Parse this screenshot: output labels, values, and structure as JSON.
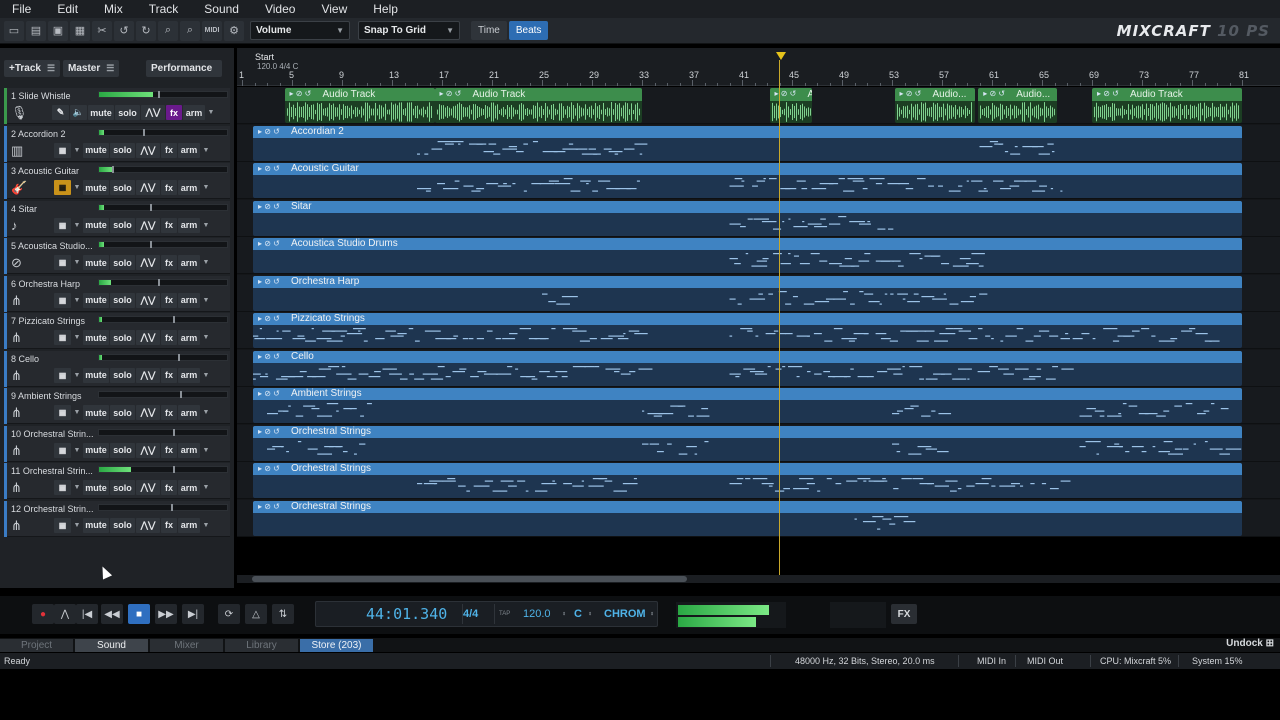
{
  "menu": [
    "File",
    "Edit",
    "Mix",
    "Track",
    "Sound",
    "Video",
    "View",
    "Help"
  ],
  "toolbar": {
    "param_select": "Volume",
    "snap_select": "Snap To Grid",
    "time_label": "Time",
    "beats_label": "Beats",
    "brand": "MIXCRAFT",
    "brand_suffix": "10 PS",
    "icons": [
      "new-icon",
      "open-icon",
      "save-icon",
      "save-as-icon",
      "cut-icon",
      "undo-icon",
      "redo-icon",
      "zoom-in-icon",
      "zoom-out-icon",
      "midi-icon",
      "settings-icon"
    ]
  },
  "track_controls": {
    "add_track": "+Track",
    "master": "Master",
    "performance": "Performance"
  },
  "buttons": {
    "mute": "mute",
    "solo": "solo",
    "fx": "fx",
    "arm": "arm"
  },
  "tracks": [
    {
      "num": "1",
      "name": "Slide Whistle",
      "icon": "microphone-icon",
      "level": 0.42,
      "pan": 0.46,
      "type": "audio",
      "fx_on": true,
      "arm_on": false
    },
    {
      "num": "2",
      "name": "Accordion 2",
      "icon": "accordion-icon",
      "level": 0.04,
      "pan": 0.34,
      "type": "midi",
      "fx_on": false,
      "arm_on": false
    },
    {
      "num": "3",
      "name": "Acoustic Guitar",
      "icon": "guitar-icon",
      "level": 0.1,
      "pan": 0.1,
      "type": "midi",
      "fx_on": false,
      "arm_on": true
    },
    {
      "num": "4",
      "name": "Sitar",
      "icon": "sitar-icon",
      "level": 0.04,
      "pan": 0.4,
      "type": "midi",
      "fx_on": false,
      "arm_on": false
    },
    {
      "num": "5",
      "name": "Acoustica Studio...",
      "icon": "drums-icon",
      "level": 0.04,
      "pan": 0.4,
      "type": "midi",
      "fx_on": false,
      "arm_on": false
    },
    {
      "num": "6",
      "name": "Orchestra Harp",
      "icon": "harp-icon",
      "level": 0.09,
      "pan": 0.46,
      "type": "midi",
      "fx_on": false,
      "arm_on": false
    },
    {
      "num": "7",
      "name": "Pizzicato Strings",
      "icon": "violin-icon",
      "level": 0.02,
      "pan": 0.58,
      "type": "midi",
      "fx_on": false,
      "arm_on": false
    },
    {
      "num": "8",
      "name": "Cello",
      "icon": "cello-icon",
      "level": 0.02,
      "pan": 0.62,
      "type": "midi",
      "fx_on": false,
      "arm_on": false
    },
    {
      "num": "9",
      "name": "Ambient Strings",
      "icon": "violin-icon",
      "level": 0.0,
      "pan": 0.63,
      "type": "midi",
      "fx_on": false,
      "arm_on": false
    },
    {
      "num": "10",
      "name": "Orchestral Strin...",
      "icon": "violin-icon",
      "level": 0.0,
      "pan": 0.58,
      "type": "midi",
      "fx_on": false,
      "arm_on": false
    },
    {
      "num": "11",
      "name": "Orchestral Strin...",
      "icon": "violin-icon",
      "level": 0.25,
      "pan": 0.58,
      "type": "midi",
      "fx_on": false,
      "arm_on": false
    },
    {
      "num": "12",
      "name": "Orchestral Strin...",
      "icon": "violin-icon",
      "level": 0.0,
      "pan": 0.56,
      "type": "midi",
      "fx_on": false,
      "arm_on": false
    }
  ],
  "ruler": {
    "start_label": "Start",
    "tempo_label": "120.0 4/4 C",
    "bars": [
      "1",
      "5",
      "9",
      "13",
      "17",
      "21",
      "25",
      "29",
      "33",
      "37",
      "41",
      "45",
      "49",
      "53",
      "57",
      "61",
      "65",
      "69",
      "73",
      "77",
      "81"
    ]
  },
  "audio_clips": [
    {
      "label": "Audio Track",
      "start_bar": 4.4,
      "end_bar": 16.4
    },
    {
      "label": "Audio Track",
      "start_bar": 16.4,
      "end_bar": 33.0
    },
    {
      "label": "Au",
      "start_bar": 43.2,
      "end_bar": 46.6
    },
    {
      "label": "Audio...",
      "start_bar": 53.2,
      "end_bar": 59.6
    },
    {
      "label": "Audio...",
      "start_bar": 59.9,
      "end_bar": 66.2
    },
    {
      "label": "Audio Track",
      "start_bar": 69.0,
      "end_bar": 81.0
    }
  ],
  "midi_clips": [
    {
      "label": "Accordian 2"
    },
    {
      "label": "Acoustic Guitar"
    },
    {
      "label": "Sitar"
    },
    {
      "label": "Acoustica Studio Drums"
    },
    {
      "label": "Orchestra Harp"
    },
    {
      "label": "Pizzicato Strings"
    },
    {
      "label": "Cello"
    },
    {
      "label": "Ambient Strings"
    },
    {
      "label": "Orchestral Strings"
    },
    {
      "label": "Orchestral Strings"
    },
    {
      "label": "Orchestral Strings"
    }
  ],
  "transport": {
    "time": "44:01.340",
    "signature": "4/4",
    "tap": "TAP",
    "tempo": "120.0",
    "key": "C",
    "scale": "CHROM",
    "fx": "FX",
    "master_level_l": 0.86,
    "master_level_r": 0.74
  },
  "tabs": [
    "Project",
    "Sound",
    "Mixer",
    "Library",
    "Store (203)"
  ],
  "active_tab": "Sound",
  "undock": "Undock",
  "status": {
    "left": "Ready",
    "audio_format": "48000 Hz, 32 Bits, Stereo, 20.0 ms",
    "midi_in": "MIDI In",
    "midi_out": "MIDI Out",
    "cpu": "CPU: Mixcraft 5%",
    "system": "System 15%"
  }
}
